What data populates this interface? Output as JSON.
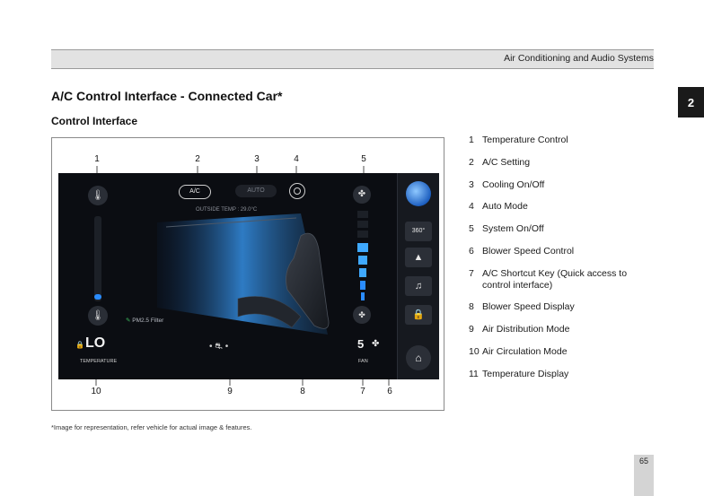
{
  "header": {
    "section": "Air Conditioning and Audio Systems"
  },
  "chapter_tab": "2",
  "title": "A/C Control Interface - Connected Car*",
  "subtitle": "Control Interface",
  "figure": {
    "callouts_top": [
      "1",
      "2",
      "3",
      "4",
      "5"
    ],
    "callouts_bottom": [
      "10",
      "9",
      "8",
      "7",
      "6"
    ],
    "screen": {
      "ac_button": "A/C",
      "auto_button": "AUTO",
      "outside_temp": "OUTSIDE TEMP : 29.0°C",
      "pm_filter": "PM2.5 Filter",
      "temp_value": "LO",
      "temp_label": "TEMPERATURE",
      "fan_value": "5",
      "fan_label": "FAN",
      "view_360": "360°"
    }
  },
  "legend": [
    {
      "num": "1",
      "text": "Temperature Control"
    },
    {
      "num": "2",
      "text": "A/C Setting"
    },
    {
      "num": "3",
      "text": "Cooling On/Off"
    },
    {
      "num": "4",
      "text": "Auto Mode"
    },
    {
      "num": "5",
      "text": "System On/Off"
    },
    {
      "num": "6",
      "text": "Blower Speed Control"
    },
    {
      "num": "7",
      "text": "A/C Shortcut Key (Quick access to control interface)"
    },
    {
      "num": "8",
      "text": "Blower Speed Display"
    },
    {
      "num": "9",
      "text": "Air Distribution Mode"
    },
    {
      "num": "10",
      "text": "Air Circulation Mode"
    },
    {
      "num": "11",
      "text": "Temperature Display"
    }
  ],
  "footnote": "*Image for representation, refer vehicle for actual image & features.",
  "page_number": "65",
  "colors": {
    "accent_blue": "#2a8cff",
    "screen_bg": "#0b0d12",
    "header_bar": "#e2e2e2"
  }
}
